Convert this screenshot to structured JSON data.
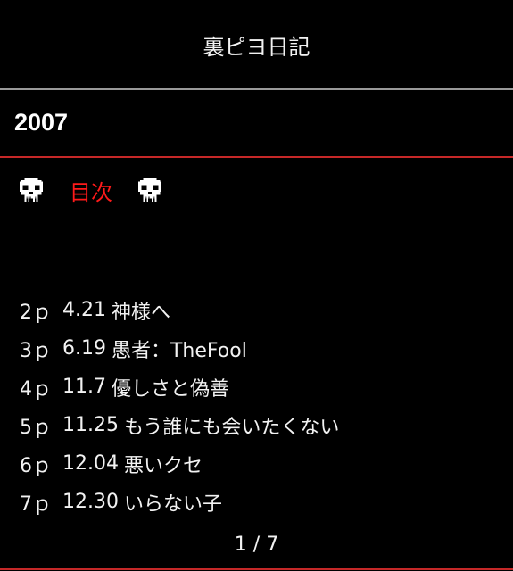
{
  "app": {
    "title": "裏ピヨ日記"
  },
  "section": {
    "year": "2007"
  },
  "toc": {
    "label": "目次",
    "icon": "skull-icon"
  },
  "entries": [
    {
      "page": "2ｐ",
      "date": "4.21",
      "title": "神様へ"
    },
    {
      "page": "3ｐ",
      "date": "6.19",
      "title": "愚者：TheFool"
    },
    {
      "page": "4ｐ",
      "date": "11.7",
      "title": "優しさと偽善"
    },
    {
      "page": "5ｐ",
      "date": "11.25",
      "title": "もう誰にも会いたくない"
    },
    {
      "page": "6ｐ",
      "date": "12.04",
      "title": "悪いクセ"
    },
    {
      "page": "7ｐ",
      "date": "12.30",
      "title": "いらない子"
    }
  ],
  "pager": {
    "label": "1 / 7"
  },
  "colors": {
    "background": "#000000",
    "accent": "#ff1a1a",
    "divider_red": "#c62828",
    "divider_gray": "#9a9a9a"
  }
}
